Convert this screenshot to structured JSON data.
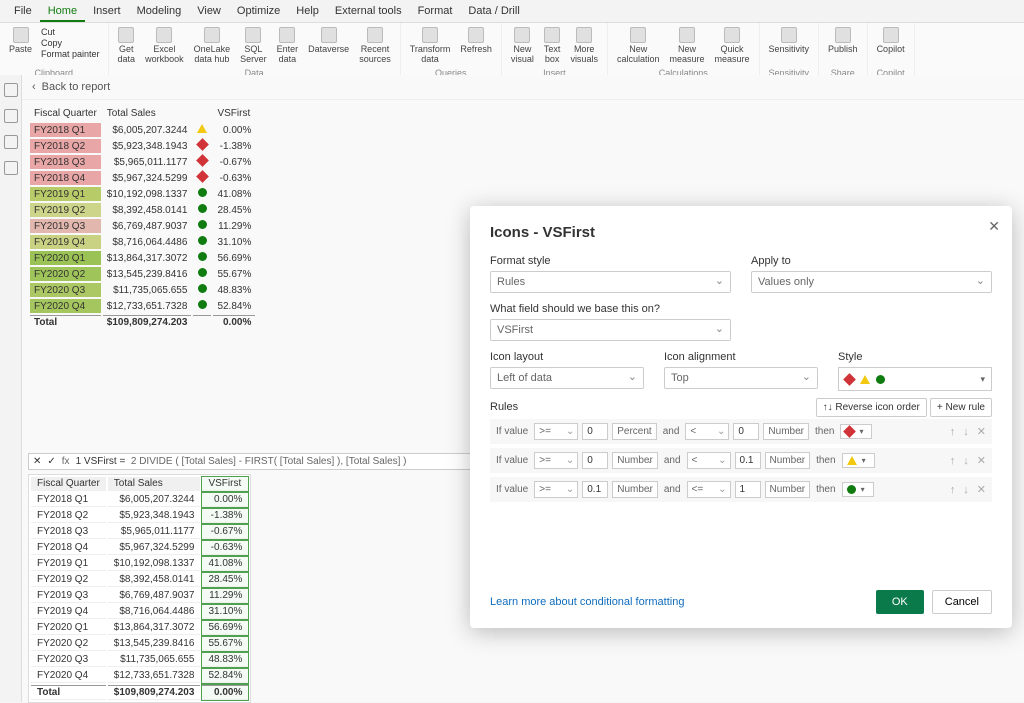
{
  "menu": [
    "File",
    "Home",
    "Insert",
    "Modeling",
    "View",
    "Optimize",
    "Help",
    "External tools",
    "Format",
    "Data / Drill"
  ],
  "menu_active": 1,
  "ribbon": {
    "clipboard": {
      "cut": "Cut",
      "copy": "Copy",
      "format_painter": "Format painter",
      "label": "Clipboard",
      "paste": "Paste"
    },
    "data": {
      "items": [
        "Get data",
        "Excel workbook",
        "OneLake data hub",
        "SQL Server",
        "Enter data",
        "Dataverse",
        "Recent sources"
      ],
      "label": "Data"
    },
    "queries": {
      "items": [
        "Transform data",
        "Refresh"
      ],
      "label": "Queries"
    },
    "insert": {
      "items": [
        "New visual",
        "Text box",
        "More visuals"
      ],
      "label": "Insert"
    },
    "calculations": {
      "items": [
        "New calculation",
        "New measure",
        "Quick measure"
      ],
      "label": "Calculations"
    },
    "sensitivity": {
      "items": [
        "Sensitivity"
      ],
      "label": "Sensitivity"
    },
    "share": {
      "items": [
        "Publish"
      ],
      "label": "Share"
    },
    "copilot": {
      "items": [
        "Copilot"
      ],
      "label": "Copilot"
    }
  },
  "back_to_report": "Back to report",
  "upper_table": {
    "cols": [
      "Fiscal Quarter",
      "Total Sales",
      "",
      "VSFirst"
    ],
    "rows": [
      {
        "q": "FY2018 Q1",
        "sales": "$6,005,207.3244",
        "icon": "triangle",
        "pct": "0.00%",
        "bg": "#e9a6a6"
      },
      {
        "q": "FY2018 Q2",
        "sales": "$5,923,348.1943",
        "icon": "diamond",
        "pct": "-1.38%",
        "bg": "#e9a6a6"
      },
      {
        "q": "FY2018 Q3",
        "sales": "$5,965,011.1177",
        "icon": "diamond",
        "pct": "-0.67%",
        "bg": "#e9a6a6"
      },
      {
        "q": "FY2018 Q4",
        "sales": "$5,967,324.5299",
        "icon": "diamond",
        "pct": "-0.63%",
        "bg": "#e9a6a6"
      },
      {
        "q": "FY2019 Q1",
        "sales": "$10,192,098.1337",
        "icon": "circle",
        "pct": "41.08%",
        "bg": "#b7cc68"
      },
      {
        "q": "FY2019 Q2",
        "sales": "$8,392,458.0141",
        "icon": "circle",
        "pct": "28.45%",
        "bg": "#cdd58a"
      },
      {
        "q": "FY2019 Q3",
        "sales": "$6,769,487.9037",
        "icon": "circle",
        "pct": "11.29%",
        "bg": "#e2b8ae"
      },
      {
        "q": "FY2019 Q4",
        "sales": "$8,716,064.4486",
        "icon": "circle",
        "pct": "31.10%",
        "bg": "#c9d283"
      },
      {
        "q": "FY2020 Q1",
        "sales": "$13,864,317.3072",
        "icon": "circle",
        "pct": "56.69%",
        "bg": "#9bc255"
      },
      {
        "q": "FY2020 Q2",
        "sales": "$13,545,239.8416",
        "icon": "circle",
        "pct": "55.67%",
        "bg": "#9fc459"
      },
      {
        "q": "FY2020 Q3",
        "sales": "$11,735,065.655",
        "icon": "circle",
        "pct": "48.83%",
        "bg": "#acc864"
      },
      {
        "q": "FY2020 Q4",
        "sales": "$12,733,651.7328",
        "icon": "circle",
        "pct": "52.84%",
        "bg": "#a5c65e"
      }
    ],
    "total": {
      "label": "Total",
      "sales": "$109,809,274.203",
      "pct": "0.00%"
    }
  },
  "formula": {
    "line1": "1  VSFirst =",
    "line2": "2  DIVIDE ( [Total Sales] - FIRST( [Total Sales] ), [Total Sales] )"
  },
  "lower_table": {
    "cols": [
      "Fiscal Quarter",
      "Total Sales",
      "VSFirst"
    ],
    "rows": [
      {
        "q": "FY2018 Q1",
        "sales": "$6,005,207.3244",
        "v": "0.00%"
      },
      {
        "q": "FY2018 Q2",
        "sales": "$5,923,348.1943",
        "v": "-1.38%"
      },
      {
        "q": "FY2018 Q3",
        "sales": "$5,965,011.1177",
        "v": "-0.67%"
      },
      {
        "q": "FY2018 Q4",
        "sales": "$5,967,324.5299",
        "v": "-0.63%"
      },
      {
        "q": "FY2019 Q1",
        "sales": "$10,192,098.1337",
        "v": "41.08%"
      },
      {
        "q": "FY2019 Q2",
        "sales": "$8,392,458.0141",
        "v": "28.45%"
      },
      {
        "q": "FY2019 Q3",
        "sales": "$6,769,487.9037",
        "v": "11.29%"
      },
      {
        "q": "FY2019 Q4",
        "sales": "$8,716,064.4486",
        "v": "31.10%"
      },
      {
        "q": "FY2020 Q1",
        "sales": "$13,864,317.3072",
        "v": "56.69%"
      },
      {
        "q": "FY2020 Q2",
        "sales": "$13,545,239.8416",
        "v": "55.67%"
      },
      {
        "q": "FY2020 Q3",
        "sales": "$11,735,065.655",
        "v": "48.83%"
      },
      {
        "q": "FY2020 Q4",
        "sales": "$12,733,651.7328",
        "v": "52.84%"
      }
    ],
    "total": {
      "label": "Total",
      "sales": "$109,809,274.203",
      "v": "0.00%"
    }
  },
  "dialog": {
    "title": "Icons - VSFirst",
    "format_style_label": "Format style",
    "format_style_value": "Rules",
    "apply_to_label": "Apply to",
    "apply_to_value": "Values only",
    "base_field_label": "What field should we base this on?",
    "base_field_value": "VSFirst",
    "icon_layout_label": "Icon layout",
    "icon_layout_value": "Left of data",
    "icon_alignment_label": "Icon alignment",
    "icon_alignment_value": "Top",
    "style_label": "Style",
    "rules_label": "Rules",
    "reverse_label": "↑↓ Reverse icon order",
    "new_rule_label": "+ New rule",
    "rules": [
      {
        "if": "If value",
        "op1": ">=",
        "v1": "0",
        "u1": "Percent",
        "and": "and",
        "op2": "<",
        "v2": "0",
        "u2": "Number",
        "then": "then",
        "icon": "diamond"
      },
      {
        "if": "If value",
        "op1": ">=",
        "v1": "0",
        "u1": "Number",
        "and": "and",
        "op2": "<",
        "v2": "0.1",
        "u2": "Number",
        "then": "then",
        "icon": "triangle"
      },
      {
        "if": "If value",
        "op1": ">=",
        "v1": "0.1",
        "u1": "Number",
        "and": "and",
        "op2": "<=",
        "v2": "1",
        "u2": "Number",
        "then": "then",
        "icon": "circle"
      }
    ],
    "learn_more": "Learn more about conditional formatting",
    "ok": "OK",
    "cancel": "Cancel"
  }
}
